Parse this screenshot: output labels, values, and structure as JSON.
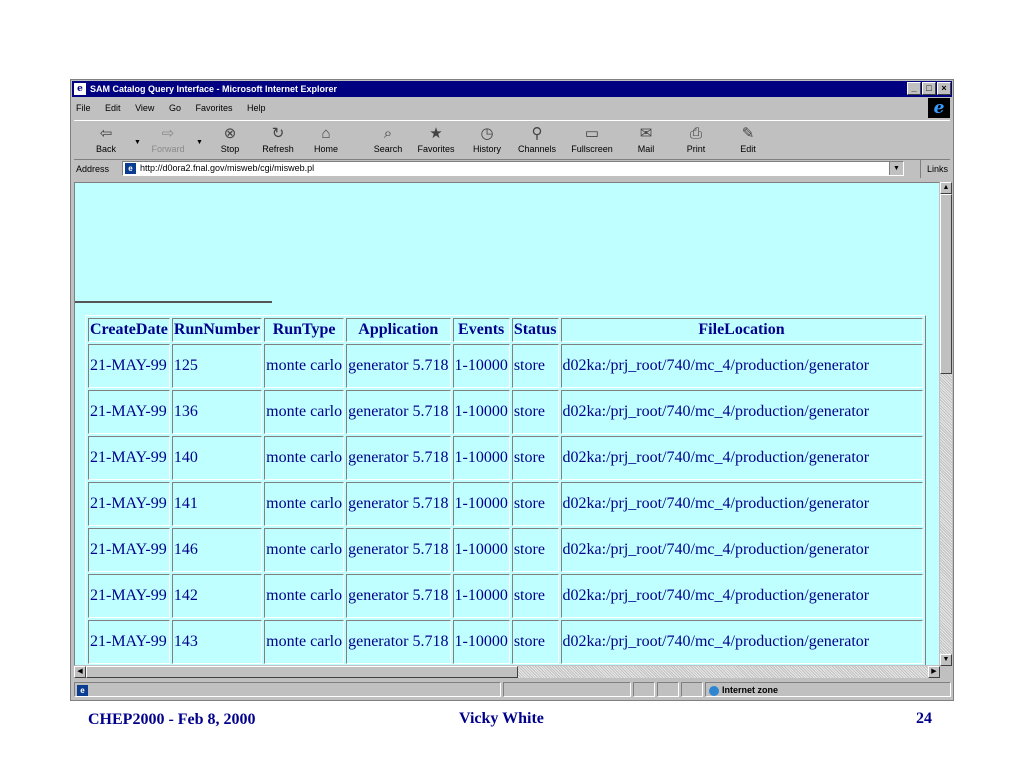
{
  "window": {
    "title": "SAM Catalog Query Interface - Microsoft Internet Explorer",
    "controls": [
      "_",
      "□",
      "×"
    ]
  },
  "menu": [
    "File",
    "Edit",
    "View",
    "Go",
    "Favorites",
    "Help"
  ],
  "toolbar": {
    "buttons": [
      {
        "label": "Back",
        "icon": "back-arrow-icon",
        "glyph": "⇦"
      },
      {
        "label": "Forward",
        "icon": "forward-arrow-icon",
        "glyph": "⇨"
      },
      {
        "label": "Stop",
        "icon": "stop-icon",
        "glyph": "⊗"
      },
      {
        "label": "Refresh",
        "icon": "refresh-icon",
        "glyph": "↻"
      },
      {
        "label": "Home",
        "icon": "home-icon",
        "glyph": "⌂"
      },
      {
        "label": "Search",
        "icon": "search-icon",
        "glyph": "⌕"
      },
      {
        "label": "Favorites",
        "icon": "favorites-icon",
        "glyph": "★"
      },
      {
        "label": "History",
        "icon": "history-icon",
        "glyph": "◷"
      },
      {
        "label": "Channels",
        "icon": "channels-icon",
        "glyph": "⚲"
      },
      {
        "label": "Fullscreen",
        "icon": "fullscreen-icon",
        "glyph": "▭"
      },
      {
        "label": "Mail",
        "icon": "mail-icon",
        "glyph": "✉"
      },
      {
        "label": "Print",
        "icon": "print-icon",
        "glyph": "⎙"
      },
      {
        "label": "Edit",
        "icon": "edit-icon",
        "glyph": "✎"
      }
    ]
  },
  "address": {
    "label": "Address",
    "url": "http://d0ora2.fnal.gov/misweb/cgi/misweb.pl",
    "links_label": "Links"
  },
  "table": {
    "headers": [
      "CreateDate",
      "RunNumber",
      "RunType",
      "Application",
      "Events",
      "Status",
      "FileLocation"
    ],
    "rows": [
      {
        "createdate": "21-MAY-99",
        "runnumber": "125",
        "runtype": "monte carlo",
        "application": "generator 5.718",
        "events": "1-10000",
        "status": "store",
        "filelocation": "d02ka:/prj_root/740/mc_4/production/generator"
      },
      {
        "createdate": "21-MAY-99",
        "runnumber": "136",
        "runtype": "monte carlo",
        "application": "generator 5.718",
        "events": "1-10000",
        "status": "store",
        "filelocation": "d02ka:/prj_root/740/mc_4/production/generator"
      },
      {
        "createdate": "21-MAY-99",
        "runnumber": "140",
        "runtype": "monte carlo",
        "application": "generator 5.718",
        "events": "1-10000",
        "status": "store",
        "filelocation": "d02ka:/prj_root/740/mc_4/production/generator"
      },
      {
        "createdate": "21-MAY-99",
        "runnumber": "141",
        "runtype": "monte carlo",
        "application": "generator 5.718",
        "events": "1-10000",
        "status": "store",
        "filelocation": "d02ka:/prj_root/740/mc_4/production/generator"
      },
      {
        "createdate": "21-MAY-99",
        "runnumber": "146",
        "runtype": "monte carlo",
        "application": "generator 5.718",
        "events": "1-10000",
        "status": "store",
        "filelocation": "d02ka:/prj_root/740/mc_4/production/generator"
      },
      {
        "createdate": "21-MAY-99",
        "runnumber": "142",
        "runtype": "monte carlo",
        "application": "generator 5.718",
        "events": "1-10000",
        "status": "store",
        "filelocation": "d02ka:/prj_root/740/mc_4/production/generator"
      },
      {
        "createdate": "21-MAY-99",
        "runnumber": "143",
        "runtype": "monte carlo",
        "application": "generator 5.718",
        "events": "1-10000",
        "status": "store",
        "filelocation": "d02ka:/prj_root/740/mc_4/production/generator"
      }
    ]
  },
  "statusbar": {
    "zone": "Internet zone"
  },
  "footer": {
    "left": "CHEP2000 - Feb 8, 2000",
    "center": "Vicky White",
    "page": "24"
  },
  "colors": {
    "content_bg": "#bfffff",
    "text": "#00008b",
    "titlebar": "#000080"
  }
}
